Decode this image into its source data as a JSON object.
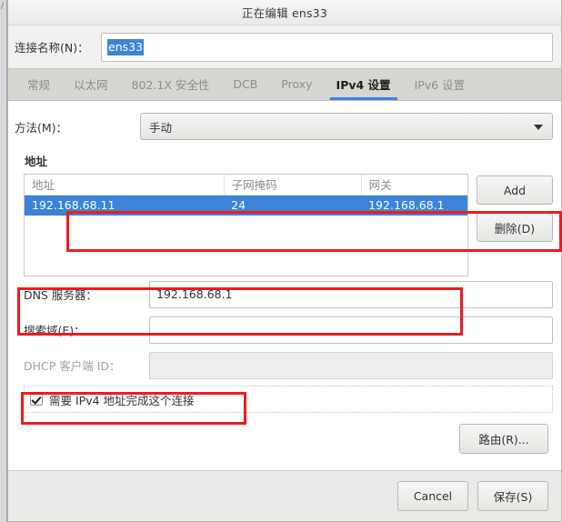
{
  "window": {
    "title": "正在编辑 ens33"
  },
  "connection": {
    "label": "连接名称(N)：",
    "value": "ens33",
    "selected": true
  },
  "tabs": [
    {
      "label": "常规",
      "active": false
    },
    {
      "label": "以太网",
      "active": false
    },
    {
      "label": "802.1X 安全性",
      "active": false
    },
    {
      "label": "DCB",
      "active": false
    },
    {
      "label": "Proxy",
      "active": false
    },
    {
      "label": "IPv4 设置",
      "active": true
    },
    {
      "label": "IPv6 设置",
      "active": false
    }
  ],
  "method": {
    "label": "方法(M)：",
    "value": "手动",
    "arrow_icon": "chevron-down-icon"
  },
  "addresses": {
    "section_title": "地址",
    "columns": [
      "地址",
      "子网掩码",
      "网关"
    ],
    "rows": [
      {
        "address": "192.168.68.11",
        "netmask": "24",
        "gateway": "192.168.68.1",
        "selected": true
      }
    ],
    "add_button": "Add",
    "delete_button": "删除(D)"
  },
  "fields": {
    "dns": {
      "label": "DNS 服务器：",
      "value": "192.168.68.1",
      "placeholder": "",
      "disabled": false
    },
    "search_domains": {
      "label": "搜索域(E)：",
      "value": "",
      "placeholder": "",
      "disabled": false
    },
    "dhcp_client_id": {
      "label": "DHCP 客户端 ID：",
      "value": "",
      "placeholder": "",
      "disabled": true
    }
  },
  "require_ipv4": {
    "label": "需要 IPv4 地址完成这个连接",
    "checked": true
  },
  "routes_button": "路由(R)...",
  "footer": {
    "cancel": "Cancel",
    "save": "保存(S)"
  },
  "colors": {
    "accent_blue": "#3b84d8",
    "annotation_red": "#ee1b22",
    "dialog_bg": "#f2f1f0",
    "page_bg": "#ffffff",
    "tabstrip_bg": "#d8d6d2"
  }
}
